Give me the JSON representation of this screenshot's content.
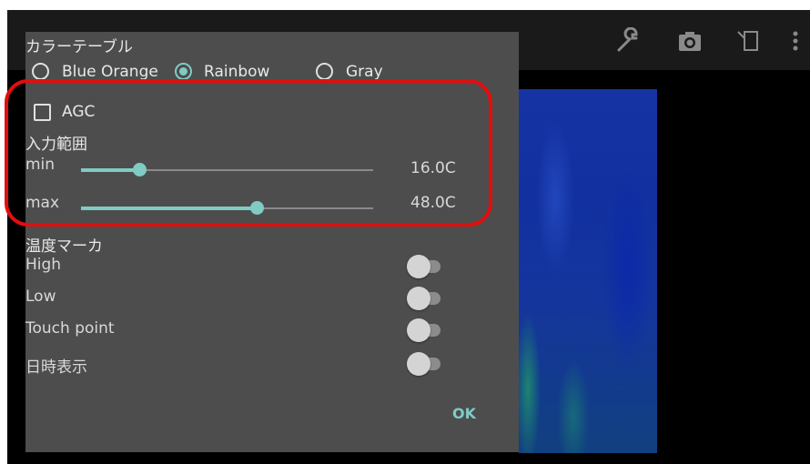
{
  "toolbar": {
    "icons": [
      "wrench-icon",
      "camera-icon",
      "split-view-icon",
      "more-vert-icon"
    ]
  },
  "dialog": {
    "color_table": {
      "title": "カラーテーブル",
      "options": [
        "Blue Orange",
        "Rainbow",
        "Gray"
      ],
      "selected": "Rainbow"
    },
    "agc": {
      "label": "AGC",
      "checked": false
    },
    "input_range": {
      "title": "入力範囲",
      "min": {
        "label": "min",
        "value_text": "16.0C",
        "fraction": 0.2
      },
      "max": {
        "label": "max",
        "value_text": "48.0C",
        "fraction": 0.6
      }
    },
    "temp_marker": {
      "title": "温度マーカ",
      "items": [
        {
          "label": "High",
          "on": false
        },
        {
          "label": "Low",
          "on": false
        },
        {
          "label": "Touch point",
          "on": false
        },
        {
          "label": "日時表示",
          "on": false
        }
      ]
    },
    "ok_label": "OK"
  },
  "colors": {
    "accent": "#80cbc4",
    "dialog_bg": "#4d4d4d",
    "highlight": "#e10e0e"
  }
}
